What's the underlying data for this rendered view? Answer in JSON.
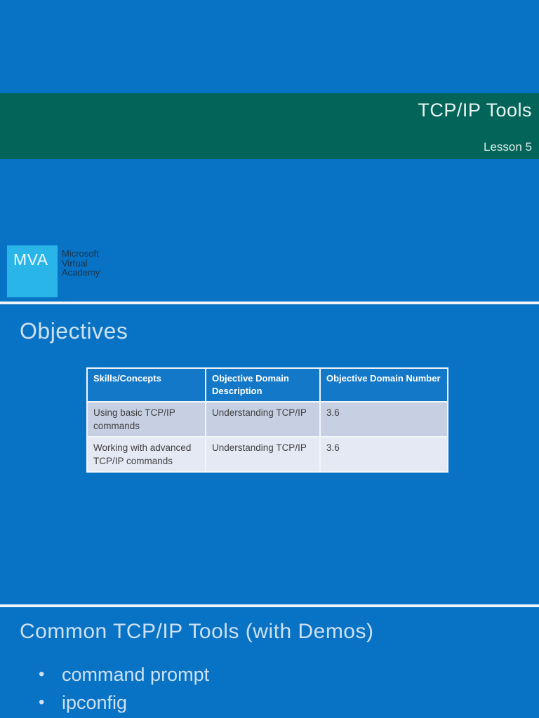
{
  "colors": {
    "slide_background": "#0872c4",
    "title_band": "#03655a",
    "logo_square": "#29b5e8",
    "table_header_bg": "#1478c8",
    "table_row_odd_bg": "#c7d0e3",
    "table_row_even_bg": "#e5e9f4",
    "heading_text": "#cde1f2",
    "brand_text": "#16344c"
  },
  "title_slide": {
    "title": "TCP/IP Tools",
    "lesson": "Lesson 5",
    "logo_text": "MVA",
    "brand_lines": [
      "Microsoft",
      "Virtual",
      "Academy"
    ]
  },
  "objectives_slide": {
    "heading": "Objectives",
    "table": {
      "headers": [
        "Skills/Concepts",
        "Objective Domain Description",
        "Objective Domain Number"
      ],
      "rows": [
        [
          "Using basic TCP/IP commands",
          "Understanding TCP/IP",
          "3.6"
        ],
        [
          "Working with advanced TCP/IP commands",
          "Understanding TCP/IP",
          "3.6"
        ]
      ]
    }
  },
  "tools_slide": {
    "heading": "Common TCP/IP Tools (with Demos)",
    "bullets": [
      "command prompt",
      "ipconfig"
    ]
  }
}
